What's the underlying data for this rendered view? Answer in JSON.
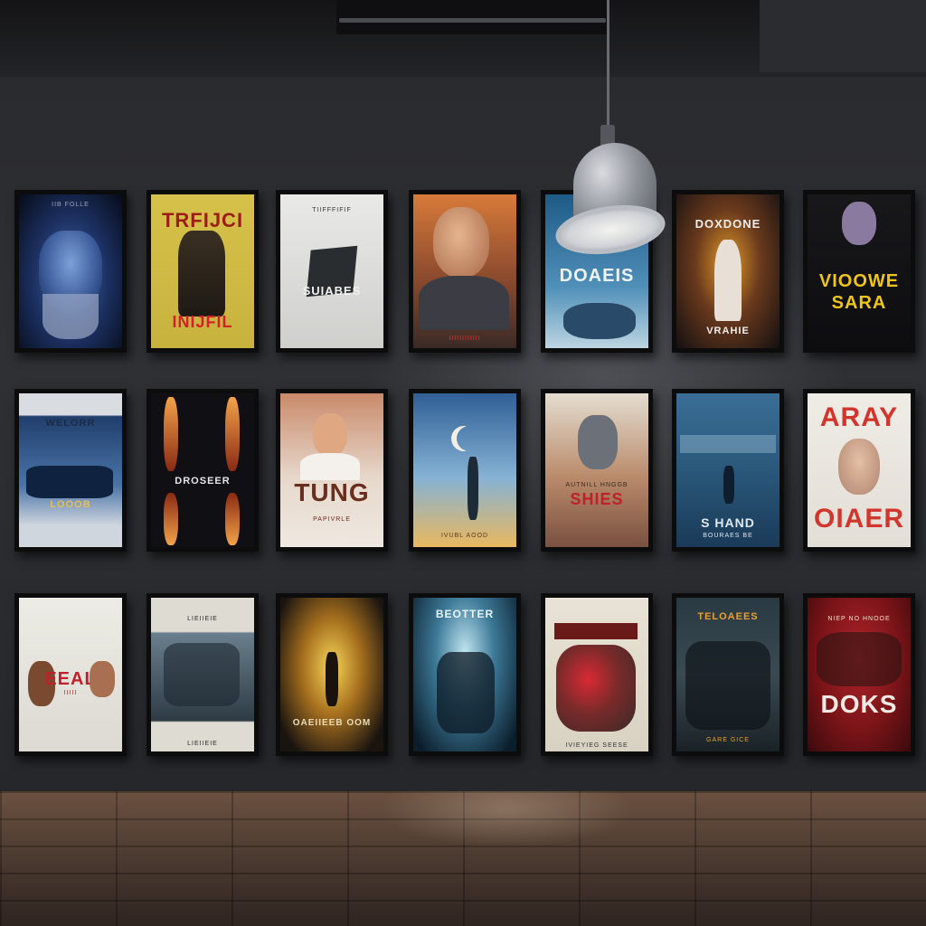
{
  "posters": [
    {
      "title": "",
      "fine": "IIB FOLLE"
    },
    {
      "title": "TRFIJCI",
      "sub": "INIJFIL"
    },
    {
      "title": "SUIABES",
      "fine": "TIIFFFIFIF"
    },
    {
      "title": "",
      "fine": "IIIIIIIIIIII"
    },
    {
      "title": "DOAEIS",
      "fine": ""
    },
    {
      "title": "DOXDONE",
      "sub": "VRAHIE"
    },
    {
      "title": "VIOOWE",
      "sub": "SARA"
    },
    {
      "title": "WELORR",
      "sub": "LOOOB"
    },
    {
      "title": "DROSEER",
      "fine": ""
    },
    {
      "title": "TUNG",
      "fine": "PAPIVRLE"
    },
    {
      "title": "",
      "fine": "IVUBL AOOD"
    },
    {
      "title": "SHIES",
      "fine": "AUTNILL HNGGB"
    },
    {
      "title": "S HAND",
      "sub": "BOURAES BE"
    },
    {
      "title": "ARAY",
      "sub": "OIAER"
    },
    {
      "title": "EEAL",
      "sub": "IIIII"
    },
    {
      "title": "LIEIIEIE",
      "sub": "LIEIIEIE"
    },
    {
      "title": "OAEIIEEB OOM",
      "fine": ""
    },
    {
      "title": "BEOTTER",
      "fine": ""
    },
    {
      "title": "",
      "fine": "IVIEYIEG SEESE"
    },
    {
      "title": "TELOAEES",
      "sub": "GARE GICE"
    },
    {
      "title": "DOKS",
      "sub": "NIEP NO HNOOE"
    }
  ]
}
